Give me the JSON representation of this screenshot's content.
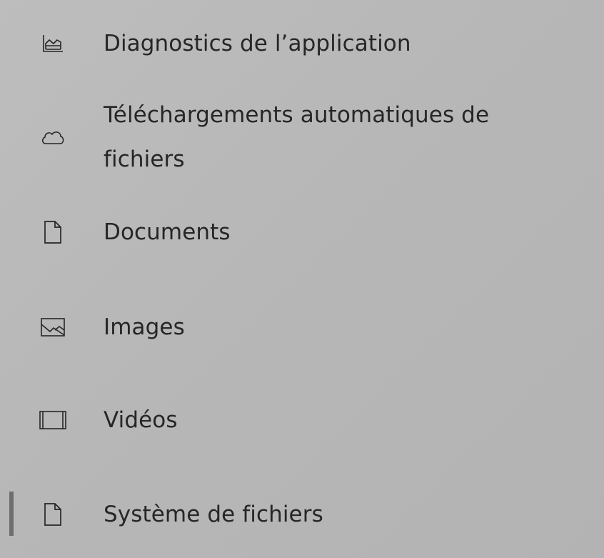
{
  "nav": {
    "items": [
      {
        "label": "Diagnostics de l’application",
        "icon": "chart-icon",
        "selected": false
      },
      {
        "label": "Téléchargements automatiques de fichiers",
        "icon": "cloud-icon",
        "selected": false
      },
      {
        "label": "Documents",
        "icon": "document-icon",
        "selected": false
      },
      {
        "label": "Images",
        "icon": "image-icon",
        "selected": false
      },
      {
        "label": "Vidéos",
        "icon": "video-icon",
        "selected": false
      },
      {
        "label": "Système de fichiers",
        "icon": "document-icon",
        "selected": true
      }
    ]
  },
  "colors": {
    "background": "#b8b8b8",
    "text": "#262626",
    "selection_indicator": "#6e6e6e"
  }
}
